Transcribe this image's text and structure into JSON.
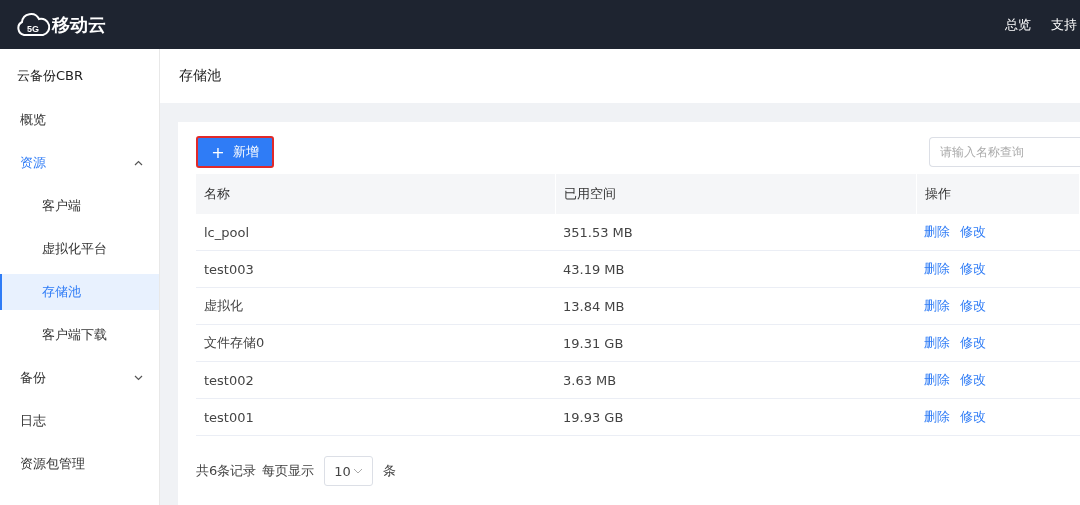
{
  "header": {
    "logo": {
      "badge": "5G",
      "text": "移动云"
    },
    "nav": [
      "总览",
      "支持"
    ]
  },
  "sidebar": {
    "title": "云备份CBR",
    "items": [
      {
        "label": "概览",
        "selected": false
      },
      {
        "label": "资源",
        "selected": false,
        "expanded": true,
        "children": [
          {
            "label": "客户端",
            "selected": false
          },
          {
            "label": "虚拟化平台",
            "selected": false
          },
          {
            "label": "存储池",
            "selected": true
          },
          {
            "label": "客户端下载",
            "selected": false
          }
        ]
      },
      {
        "label": "备份",
        "selected": false,
        "expanded": false
      },
      {
        "label": "日志",
        "selected": false
      },
      {
        "label": "资源包管理",
        "selected": false
      }
    ]
  },
  "page": {
    "title": "存储池"
  },
  "toolbar": {
    "add_button": {
      "icon": "+",
      "label": "新增"
    },
    "search": {
      "placeholder": "请输入名称查询"
    }
  },
  "table": {
    "columns": [
      "名称",
      "已用空间",
      "操作"
    ],
    "rows": [
      {
        "name": "lc_pool",
        "used": "351.53 MB",
        "actions": [
          "删除",
          "修改"
        ]
      },
      {
        "name": "test003",
        "used": "43.19 MB",
        "actions": [
          "删除",
          "修改"
        ]
      },
      {
        "name": "虚拟化",
        "used": "13.84 MB",
        "actions": [
          "删除",
          "修改"
        ]
      },
      {
        "name": "文件存储0",
        "used": "19.31 GB",
        "actions": [
          "删除",
          "修改"
        ]
      },
      {
        "name": "test002",
        "used": "3.63 MB",
        "actions": [
          "删除",
          "修改"
        ]
      },
      {
        "name": "test001",
        "used": "19.93 GB",
        "actions": [
          "删除",
          "修改"
        ]
      }
    ]
  },
  "pagination": {
    "total": "共6条记录",
    "per_page_label": "每页显示",
    "page_size": "10",
    "unit": "条"
  }
}
